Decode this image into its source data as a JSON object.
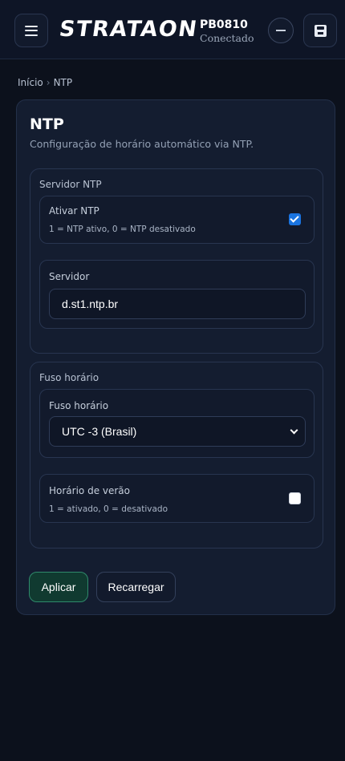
{
  "header": {
    "brand": "STRATAON",
    "device_id": "PB0810",
    "connection_status": "Conectado",
    "icons": [
      "menu-icon",
      "minus-icon",
      "save-icon"
    ]
  },
  "breadcrumb": {
    "home": "Início",
    "separator": "›",
    "current": "NTP"
  },
  "page": {
    "title": "NTP",
    "subtitle": "Configuração de horário automático via NTP."
  },
  "ntp_server_section": {
    "title": "Servidor NTP",
    "enable": {
      "label": "Ativar NTP",
      "hint": "1 = NTP ativo, 0 = NTP desativado",
      "checked": true
    },
    "server": {
      "label": "Servidor",
      "value": "d.st1.ntp.br"
    }
  },
  "timezone_section": {
    "title": "Fuso horário",
    "timezone": {
      "label": "Fuso horário",
      "selected": "UTC -3 (Brasil)"
    },
    "dst": {
      "label": "Horário de verão",
      "hint": "1 = ativado, 0 = desativado",
      "checked": false
    }
  },
  "actions": {
    "apply": "Aplicar",
    "reload": "Recarregar"
  },
  "colors": {
    "background": "#0c111c",
    "card": "#141d30",
    "accent_checkbox": "#1a74e0",
    "apply_border": "#2f8a6b"
  }
}
